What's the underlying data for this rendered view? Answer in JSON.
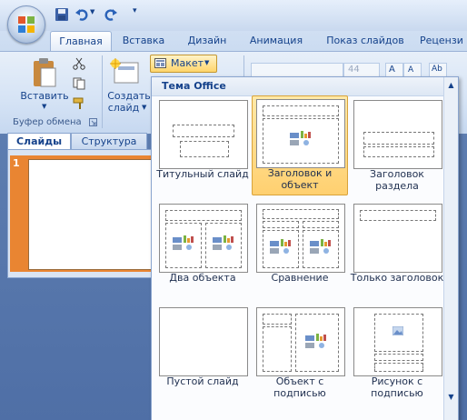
{
  "tabs": [
    "Главная",
    "Вставка",
    "Дизайн",
    "Анимация",
    "Показ слайдов",
    "Рецензи"
  ],
  "ribbon": {
    "paste_label": "Вставить",
    "create_label_1": "Создать",
    "create_label_2": "слайд",
    "layout_button": "Макет",
    "clipboard_group": "Буфер обмена",
    "font_size": "44"
  },
  "pane": {
    "tab_slides": "Слайды",
    "tab_outline": "Структура",
    "slide_number": "1"
  },
  "gallery": {
    "title": "Тема Office",
    "layouts": [
      {
        "label_1": "Титульный слайд",
        "label_2": ""
      },
      {
        "label_1": "Заголовок и",
        "label_2": "объект"
      },
      {
        "label_1": "Заголовок",
        "label_2": "раздела"
      },
      {
        "label_1": "Два объекта",
        "label_2": ""
      },
      {
        "label_1": "Сравнение",
        "label_2": ""
      },
      {
        "label_1": "Только заголовок",
        "label_2": ""
      },
      {
        "label_1": "Пустой слайд",
        "label_2": ""
      },
      {
        "label_1": "Объект с",
        "label_2": "подписью"
      },
      {
        "label_1": "Рисунок с",
        "label_2": "подписью"
      }
    ],
    "selected_index": 1
  },
  "colors": {
    "accent_selected": "#ffd070",
    "slide_row_highlight": "#e98532",
    "ribbon_text": "#15428b"
  }
}
